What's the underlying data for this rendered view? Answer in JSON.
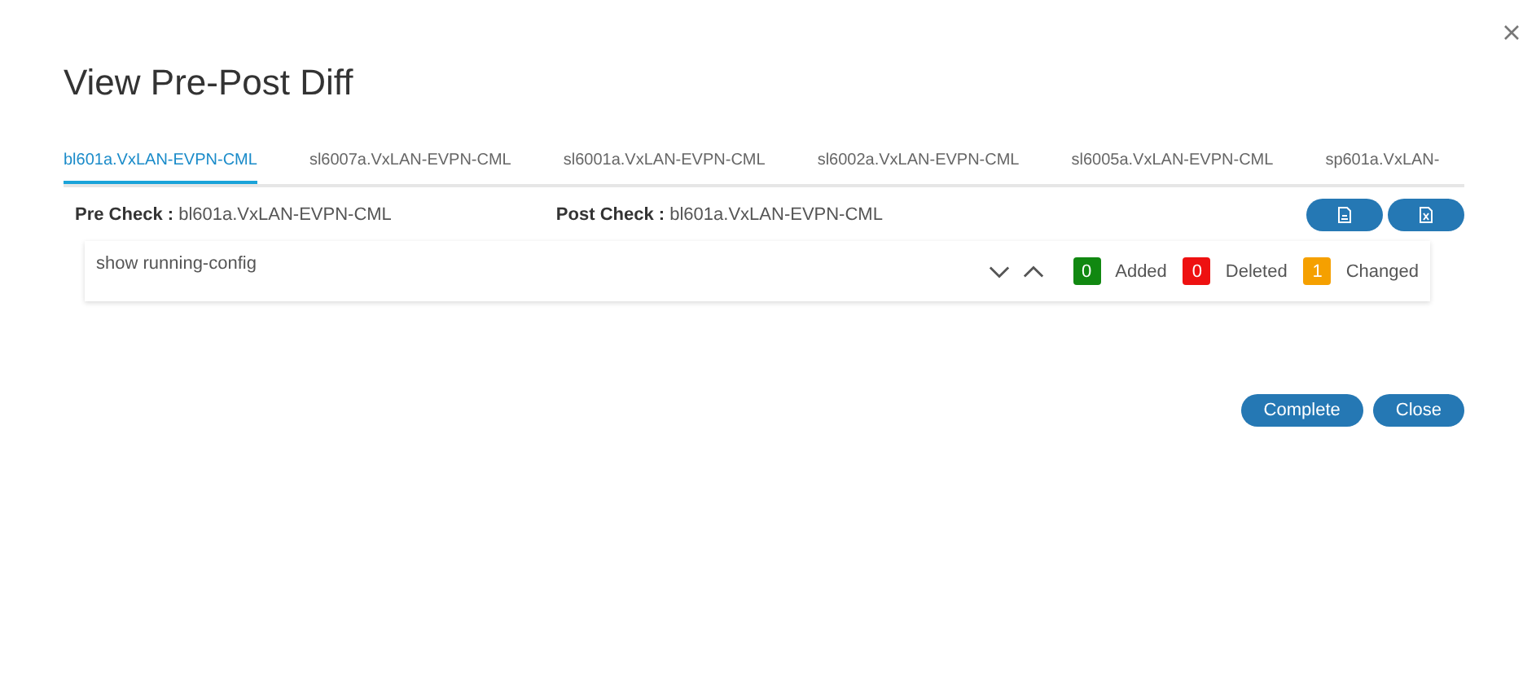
{
  "dialog": {
    "title": "View Pre-Post Diff"
  },
  "tabs": [
    {
      "label": "bl601a.VxLAN-EVPN-CML",
      "selected": true
    },
    {
      "label": "sl6007a.VxLAN-EVPN-CML",
      "selected": false
    },
    {
      "label": "sl6001a.VxLAN-EVPN-CML",
      "selected": false
    },
    {
      "label": "sl6002a.VxLAN-EVPN-CML",
      "selected": false
    },
    {
      "label": "sl6005a.VxLAN-EVPN-CML",
      "selected": false
    },
    {
      "label": "sp601a.VxLAN-",
      "selected": false
    }
  ],
  "pre_check": {
    "label": "Pre Check :",
    "value": "bl601a.VxLAN-EVPN-CML"
  },
  "post_check": {
    "label": "Post Check :",
    "value": "bl601a.VxLAN-EVPN-CML"
  },
  "diff": {
    "command": "show running-config",
    "legend": [
      {
        "count": "0",
        "label": "Added",
        "color": "#118811"
      },
      {
        "count": "0",
        "label": "Deleted",
        "color": "#ee1111"
      },
      {
        "count": "1",
        "label": "Changed",
        "color": "#f5a000"
      }
    ]
  },
  "buttons": [
    "Complete",
    "Close"
  ]
}
